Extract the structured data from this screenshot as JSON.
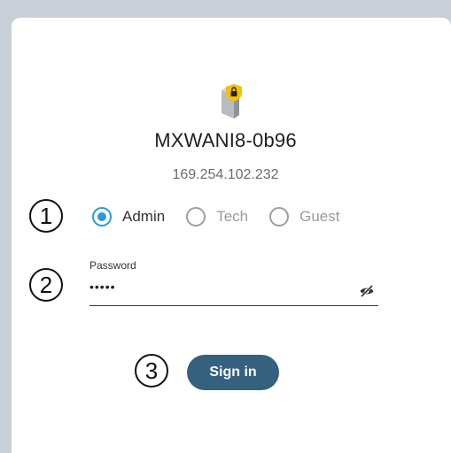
{
  "device": {
    "name": "MXWANI8-0b96",
    "ip": "169.254.102.232",
    "icon": "device-lock-icon"
  },
  "steps": [
    "1",
    "2",
    "3"
  ],
  "roles": {
    "options": [
      {
        "label": "Admin",
        "selected": true
      },
      {
        "label": "Tech",
        "selected": false
      },
      {
        "label": "Guest",
        "selected": false
      }
    ]
  },
  "password": {
    "label": "Password",
    "value": "•••••",
    "toggle_icon": "eye-off-icon"
  },
  "signin": {
    "label": "Sign in"
  },
  "colors": {
    "accent": "#2b9ad8",
    "button": "#35607e",
    "background": "#c9cfd6",
    "card": "#ffffff"
  }
}
